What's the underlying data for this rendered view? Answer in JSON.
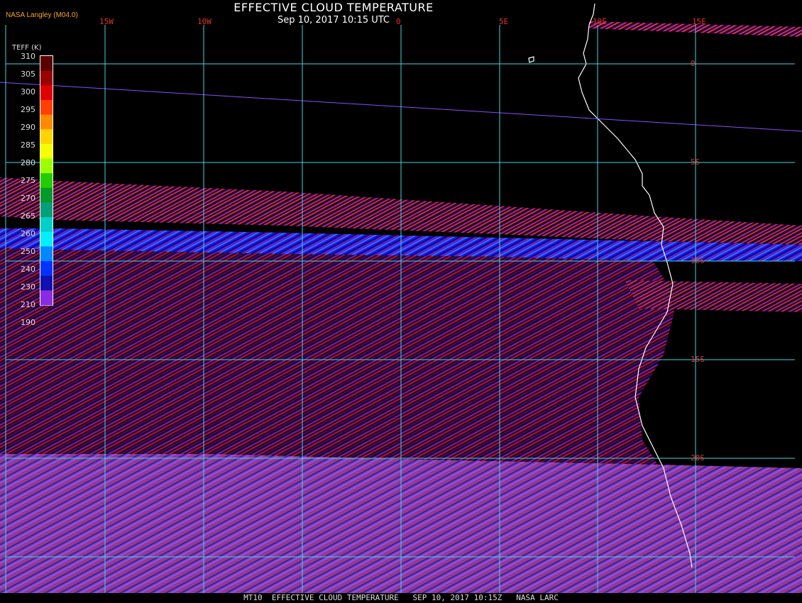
{
  "header": {
    "credit": "NASA Langley (M04.0)",
    "title": "EFFECTIVE CLOUD TEMPERATURE",
    "subtitle": "Sep 10, 2017 10:15 UTC"
  },
  "grid": {
    "lon_labels": [
      "15W",
      "10W",
      "0",
      "5E",
      "10E",
      "15E"
    ],
    "lat_labels": [
      "0",
      "5S",
      "10S",
      "15S",
      "20S"
    ]
  },
  "legend": {
    "title": "TEFF (K)",
    "labels": [
      "310",
      "305",
      "300",
      "295",
      "290",
      "285",
      "280",
      "275",
      "270",
      "265",
      "260",
      "250",
      "240",
      "230",
      "210",
      "190"
    ],
    "colors": [
      "#5a0000",
      "#9b0000",
      "#e00000",
      "#ff4000",
      "#ff8a00",
      "#ffd400",
      "#f5ff00",
      "#9bff00",
      "#22cc00",
      "#009a2a",
      "#00a07a",
      "#00d0c8",
      "#00f0ff",
      "#0088ff",
      "#0033ff",
      "#1010b0",
      "#8a2be2"
    ]
  },
  "colors": {
    "grid": "#3fd5e0",
    "coast": "#ffffff",
    "label": "#e0332e",
    "line": "#8a4bff"
  },
  "footer": {
    "text": "MT10  EFFECTIVE CLOUD TEMPERATURE   SEP 10, 2017 10:15Z   NASA LARC"
  }
}
